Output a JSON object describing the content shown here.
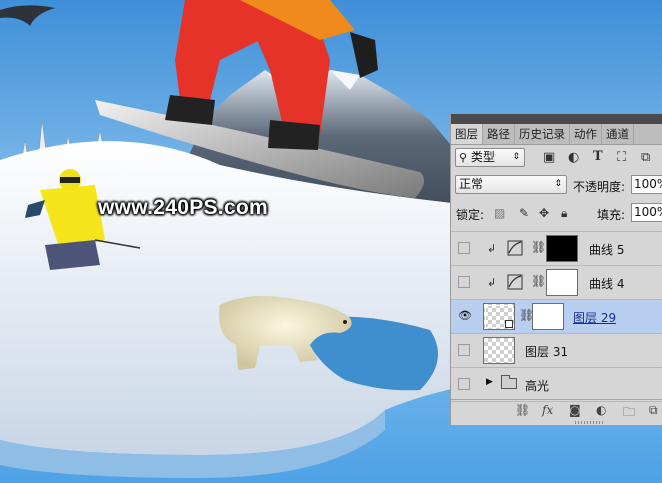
{
  "watermark": "www.240PS.com",
  "panel": {
    "tabs": [
      "图层",
      "路径",
      "历史记录",
      "动作",
      "通道"
    ],
    "active_tab": 0,
    "filter": {
      "icon": "search-icon",
      "value": "类型"
    },
    "filter_icons": [
      "image-filter-icon",
      "adjustment-filter-icon",
      "text-filter-icon",
      "shape-filter-icon",
      "smart-object-filter-icon"
    ],
    "blend_mode": "正常",
    "opacity_label": "不透明度:",
    "opacity_value": "100%",
    "lock_label": "锁定:",
    "lock_icons": [
      "lock-transparent-icon",
      "lock-paint-icon",
      "lock-position-icon",
      "lock-all-icon"
    ],
    "fill_label": "填充:",
    "fill_value": "100%",
    "layers": [
      {
        "name": "曲线 5",
        "type": "adjustment",
        "visible": false,
        "clipped": true,
        "mask": "black"
      },
      {
        "name": "曲线 4",
        "type": "adjustment",
        "visible": false,
        "clipped": true,
        "mask": "white"
      },
      {
        "name": "图层 29",
        "type": "smart-object",
        "visible": true,
        "selected": true,
        "mask": "white"
      },
      {
        "name": "图层 31",
        "type": "pixel",
        "visible": false
      },
      {
        "name": "高光",
        "type": "group",
        "visible": false
      }
    ],
    "bottom_icons": [
      "link-icon",
      "fx-icon",
      "add-mask-icon",
      "new-adjustment-icon",
      "new-group-icon",
      "new-layer-icon"
    ],
    "bottom_text": {
      "fx": "fx"
    }
  },
  "colors": {
    "sky": "#5aa6e6",
    "panel_bg": "#d6d6d6",
    "selected_row": "#b8cff0",
    "link_text": "#1a2f8c"
  }
}
